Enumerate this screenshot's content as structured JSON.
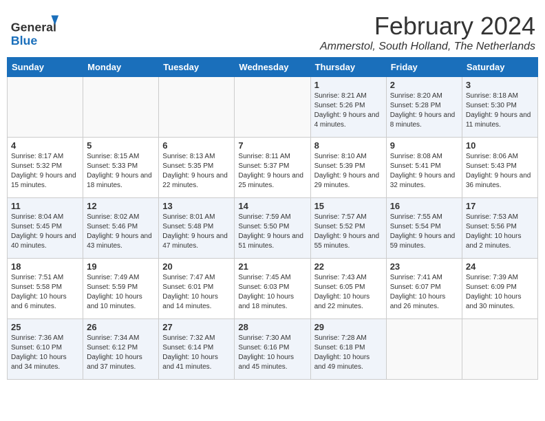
{
  "header": {
    "logo_general": "General",
    "logo_blue": "Blue",
    "month_year": "February 2024",
    "location": "Ammerstol, South Holland, The Netherlands"
  },
  "days_of_week": [
    "Sunday",
    "Monday",
    "Tuesday",
    "Wednesday",
    "Thursday",
    "Friday",
    "Saturday"
  ],
  "weeks": [
    [
      {
        "day": "",
        "info": ""
      },
      {
        "day": "",
        "info": ""
      },
      {
        "day": "",
        "info": ""
      },
      {
        "day": "",
        "info": ""
      },
      {
        "day": "1",
        "info": "Sunrise: 8:21 AM\nSunset: 5:26 PM\nDaylight: 9 hours\nand 4 minutes."
      },
      {
        "day": "2",
        "info": "Sunrise: 8:20 AM\nSunset: 5:28 PM\nDaylight: 9 hours\nand 8 minutes."
      },
      {
        "day": "3",
        "info": "Sunrise: 8:18 AM\nSunset: 5:30 PM\nDaylight: 9 hours\nand 11 minutes."
      }
    ],
    [
      {
        "day": "4",
        "info": "Sunrise: 8:17 AM\nSunset: 5:32 PM\nDaylight: 9 hours\nand 15 minutes."
      },
      {
        "day": "5",
        "info": "Sunrise: 8:15 AM\nSunset: 5:33 PM\nDaylight: 9 hours\nand 18 minutes."
      },
      {
        "day": "6",
        "info": "Sunrise: 8:13 AM\nSunset: 5:35 PM\nDaylight: 9 hours\nand 22 minutes."
      },
      {
        "day": "7",
        "info": "Sunrise: 8:11 AM\nSunset: 5:37 PM\nDaylight: 9 hours\nand 25 minutes."
      },
      {
        "day": "8",
        "info": "Sunrise: 8:10 AM\nSunset: 5:39 PM\nDaylight: 9 hours\nand 29 minutes."
      },
      {
        "day": "9",
        "info": "Sunrise: 8:08 AM\nSunset: 5:41 PM\nDaylight: 9 hours\nand 32 minutes."
      },
      {
        "day": "10",
        "info": "Sunrise: 8:06 AM\nSunset: 5:43 PM\nDaylight: 9 hours\nand 36 minutes."
      }
    ],
    [
      {
        "day": "11",
        "info": "Sunrise: 8:04 AM\nSunset: 5:45 PM\nDaylight: 9 hours\nand 40 minutes."
      },
      {
        "day": "12",
        "info": "Sunrise: 8:02 AM\nSunset: 5:46 PM\nDaylight: 9 hours\nand 43 minutes."
      },
      {
        "day": "13",
        "info": "Sunrise: 8:01 AM\nSunset: 5:48 PM\nDaylight: 9 hours\nand 47 minutes."
      },
      {
        "day": "14",
        "info": "Sunrise: 7:59 AM\nSunset: 5:50 PM\nDaylight: 9 hours\nand 51 minutes."
      },
      {
        "day": "15",
        "info": "Sunrise: 7:57 AM\nSunset: 5:52 PM\nDaylight: 9 hours\nand 55 minutes."
      },
      {
        "day": "16",
        "info": "Sunrise: 7:55 AM\nSunset: 5:54 PM\nDaylight: 9 hours\nand 59 minutes."
      },
      {
        "day": "17",
        "info": "Sunrise: 7:53 AM\nSunset: 5:56 PM\nDaylight: 10 hours\nand 2 minutes."
      }
    ],
    [
      {
        "day": "18",
        "info": "Sunrise: 7:51 AM\nSunset: 5:58 PM\nDaylight: 10 hours\nand 6 minutes."
      },
      {
        "day": "19",
        "info": "Sunrise: 7:49 AM\nSunset: 5:59 PM\nDaylight: 10 hours\nand 10 minutes."
      },
      {
        "day": "20",
        "info": "Sunrise: 7:47 AM\nSunset: 6:01 PM\nDaylight: 10 hours\nand 14 minutes."
      },
      {
        "day": "21",
        "info": "Sunrise: 7:45 AM\nSunset: 6:03 PM\nDaylight: 10 hours\nand 18 minutes."
      },
      {
        "day": "22",
        "info": "Sunrise: 7:43 AM\nSunset: 6:05 PM\nDaylight: 10 hours\nand 22 minutes."
      },
      {
        "day": "23",
        "info": "Sunrise: 7:41 AM\nSunset: 6:07 PM\nDaylight: 10 hours\nand 26 minutes."
      },
      {
        "day": "24",
        "info": "Sunrise: 7:39 AM\nSunset: 6:09 PM\nDaylight: 10 hours\nand 30 minutes."
      }
    ],
    [
      {
        "day": "25",
        "info": "Sunrise: 7:36 AM\nSunset: 6:10 PM\nDaylight: 10 hours\nand 34 minutes."
      },
      {
        "day": "26",
        "info": "Sunrise: 7:34 AM\nSunset: 6:12 PM\nDaylight: 10 hours\nand 37 minutes."
      },
      {
        "day": "27",
        "info": "Sunrise: 7:32 AM\nSunset: 6:14 PM\nDaylight: 10 hours\nand 41 minutes."
      },
      {
        "day": "28",
        "info": "Sunrise: 7:30 AM\nSunset: 6:16 PM\nDaylight: 10 hours\nand 45 minutes."
      },
      {
        "day": "29",
        "info": "Sunrise: 7:28 AM\nSunset: 6:18 PM\nDaylight: 10 hours\nand 49 minutes."
      },
      {
        "day": "",
        "info": ""
      },
      {
        "day": "",
        "info": ""
      }
    ]
  ]
}
